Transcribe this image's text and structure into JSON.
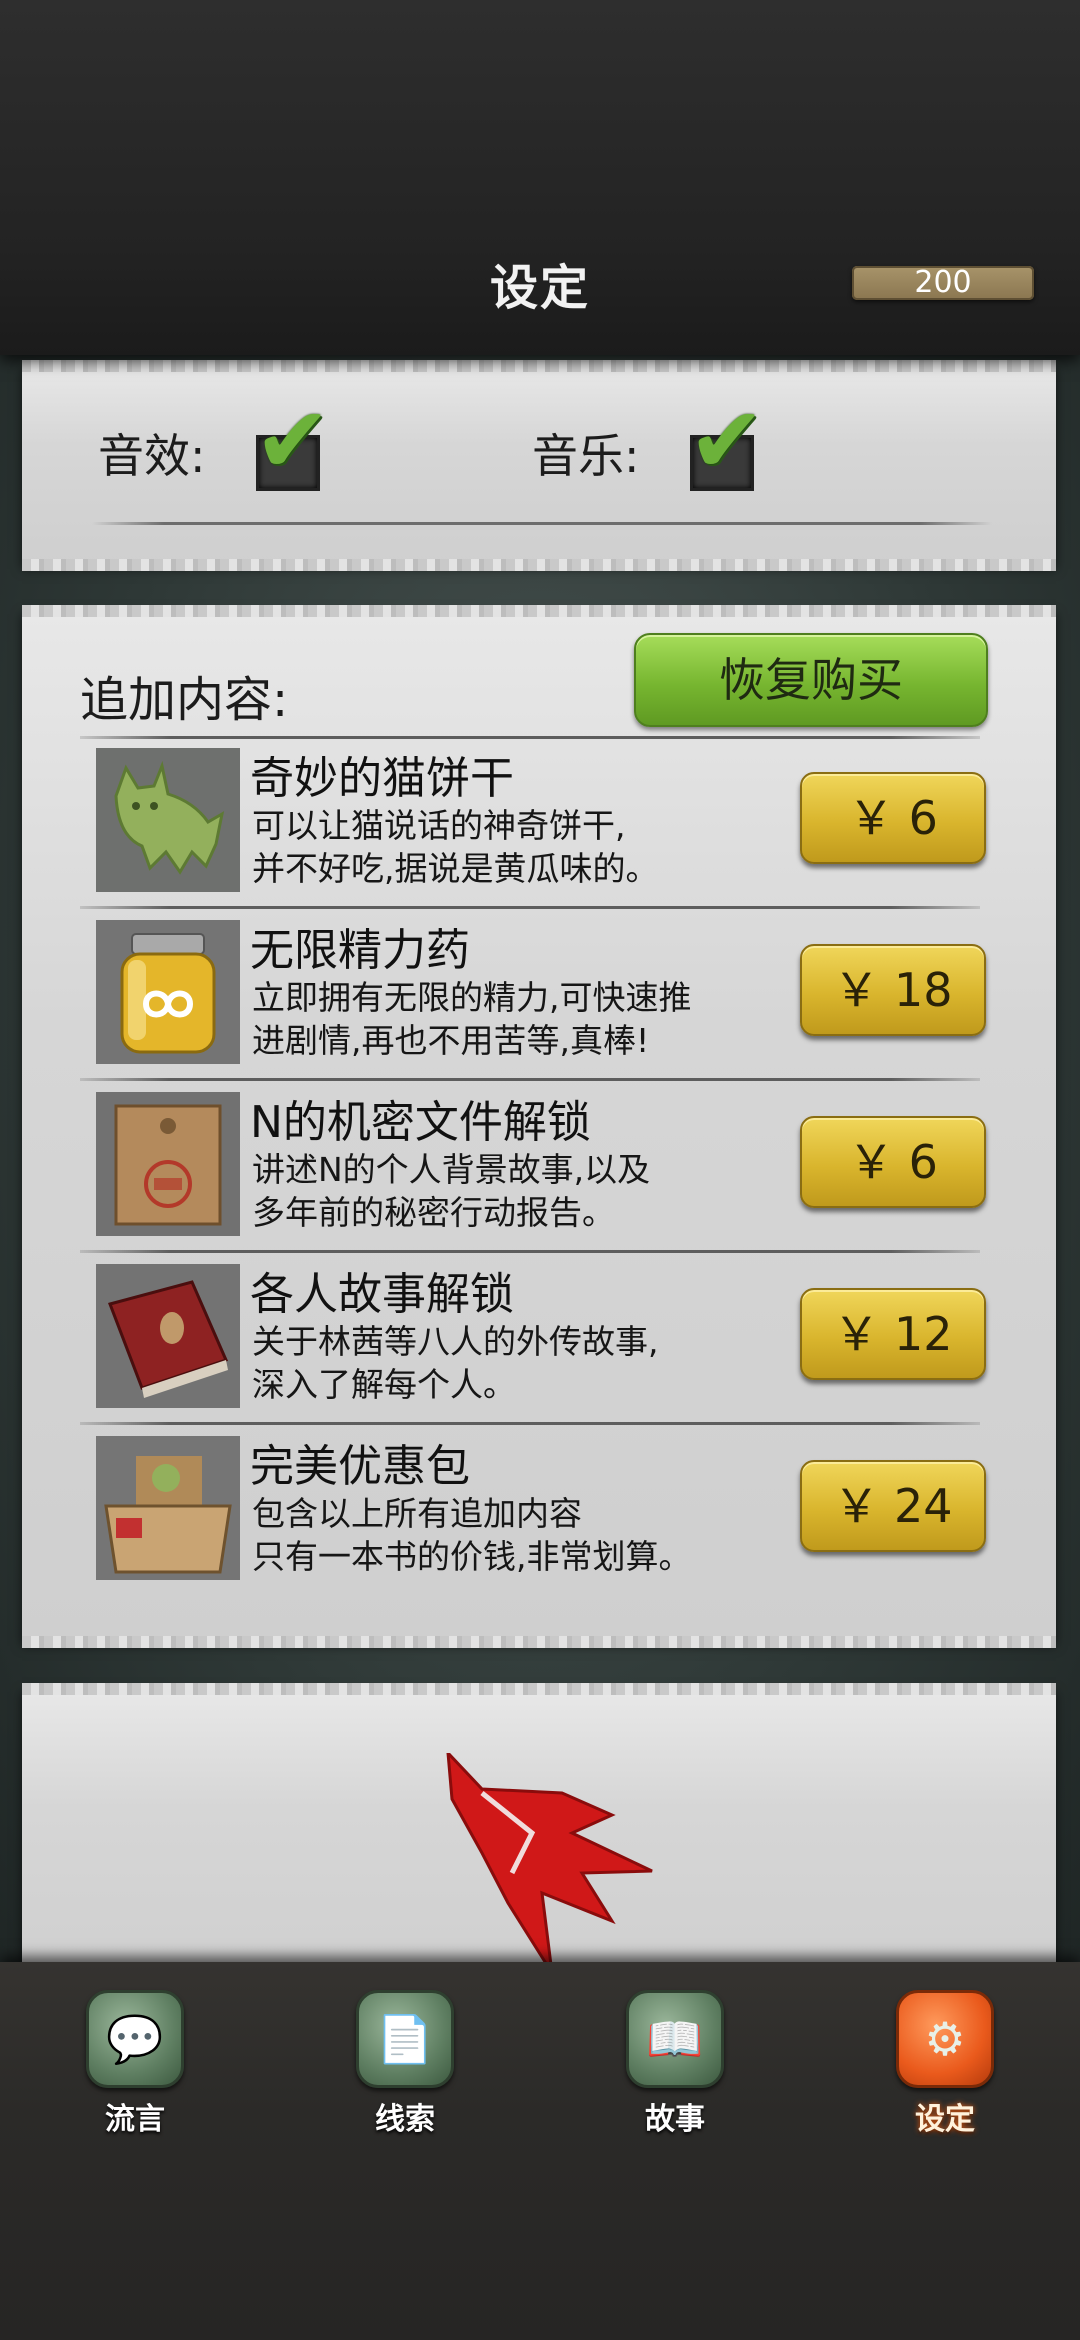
{
  "header": {
    "title": "设定",
    "coins": "200"
  },
  "settings": {
    "sound_label": "音效:",
    "music_label": "音乐:",
    "sound_checked": true,
    "music_checked": true
  },
  "store": {
    "section_label": "追加内容:",
    "restore_button": "恢复购买",
    "items": [
      {
        "name": "奇妙的猫饼干",
        "desc1": "可以让猫说话的神奇饼干,",
        "desc2": "并不好吃,据说是黄瓜味的。",
        "price": "￥ 6",
        "icon": "cat-cookie-icon"
      },
      {
        "name": "无限精力药",
        "desc1": "立即拥有无限的精力,可快速推",
        "desc2": "进剧情,再也不用苦等,真棒!",
        "price": "￥ 18",
        "icon": "potion-jar-icon"
      },
      {
        "name": "N的机密文件解锁",
        "desc1": "讲述N的个人背景故事,以及",
        "desc2": "多年前的秘密行动报告。",
        "price": "￥ 6",
        "icon": "secret-envelope-icon"
      },
      {
        "name": "各人故事解锁",
        "desc1": "关于林茜等八人的外传故事,",
        "desc2": "深入了解每个人。",
        "price": "￥ 12",
        "icon": "red-book-icon"
      },
      {
        "name": "完美优惠包",
        "desc1": "包含以上所有追加内容",
        "desc2": "只有一本书的价钱,非常划算。",
        "price": "￥ 24",
        "icon": "gift-box-icon"
      }
    ]
  },
  "bottom_nav": {
    "tabs": [
      {
        "label": "流言",
        "icon": "chat-bubble-icon",
        "active": false
      },
      {
        "label": "线索",
        "icon": "clue-paper-icon",
        "active": false
      },
      {
        "label": "故事",
        "icon": "story-book-icon",
        "active": false
      },
      {
        "label": "设定",
        "icon": "gear-icon",
        "active": true
      }
    ]
  },
  "colors": {
    "accent_green": "#77b630",
    "price_gold": "#d9b52d",
    "active_tab": "#ea5a1c",
    "logo_red": "#d01818"
  }
}
